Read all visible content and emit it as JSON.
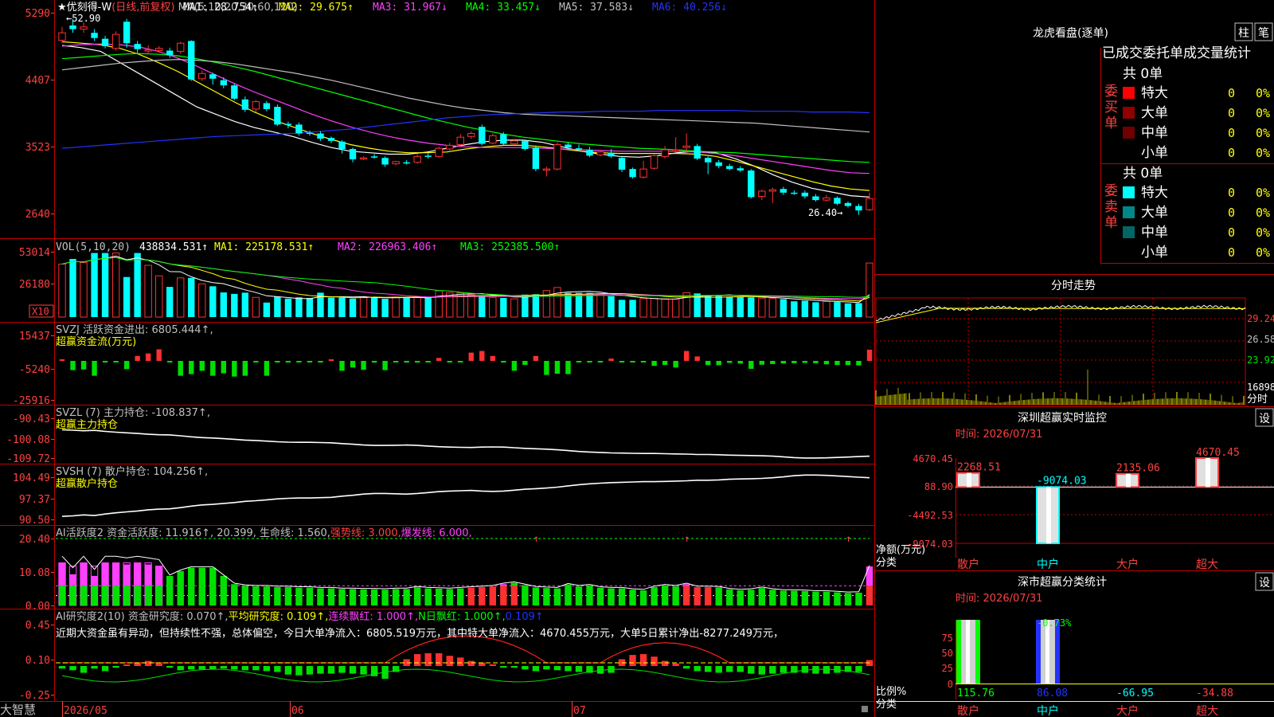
{
  "colors": {
    "up": "#ff3030",
    "down": "#00ffff",
    "vol_down": "#00ffff",
    "green": "#00e000",
    "white": "#ffffff",
    "yellow": "#ffff00",
    "magenta": "#ff40ff",
    "lime": "#00ff00",
    "blue": "#2233ff",
    "grey": "#c0c0c0",
    "frame": "#c00000"
  },
  "status_bar": {
    "brand": "大智慧"
  },
  "main_panel": {
    "title_prefix": "★",
    "stock_name": "优刻得-W",
    "period": "(日线,前复权)",
    "ma_header": "MA(5,10,20,30,60,120)",
    "ma": [
      {
        "label": "MA1: 28.754↑",
        "color": "#ffffff"
      },
      {
        "label": "MA2: 29.675↑",
        "color": "#ffff00"
      },
      {
        "label": "MA3: 31.967↓",
        "color": "#ff40ff"
      },
      {
        "label": "MA4: 33.457↓",
        "color": "#00ff00"
      },
      {
        "label": "MA5: 37.583↓",
        "color": "#c0c0c0"
      },
      {
        "label": "MA6: 40.256↓",
        "color": "#2233ff"
      }
    ],
    "y_labels": [
      "5290",
      "4407",
      "3523",
      "2640"
    ],
    "high_label": "52.90",
    "low_label": "26.40"
  },
  "vol_panel": {
    "title": "VOL(5,10,20)",
    "values": [
      {
        "label": "438834.531↑",
        "color": "#ffffff"
      },
      {
        "label": "MA1: 225178.531↑",
        "color": "#ffff00"
      },
      {
        "label": "MA2: 226963.406↑",
        "color": "#ff40ff"
      },
      {
        "label": "MA3: 252385.500↑",
        "color": "#00ff00"
      }
    ],
    "y_labels": [
      "53014",
      "26180"
    ],
    "unit": "X10"
  },
  "svzj_panel": {
    "title": "SVZJ  活跃资金进出: 6805.444↑,",
    "subtitle": "超赢资金流(万元)",
    "y_labels": [
      "15437",
      "-5240",
      "-25916"
    ]
  },
  "svzl_panel": {
    "title": "SVZL (7) 主力持仓: -108.837↑,",
    "subtitle": "超赢主力持仓",
    "y_labels": [
      "-90.43",
      "-100.08",
      "-109.72"
    ]
  },
  "svsh_panel": {
    "title": "SVSH (7) 散户持仓: 104.256↑,",
    "subtitle": "超赢散户持仓",
    "y_labels": [
      "104.49",
      "97.37",
      "90.50"
    ]
  },
  "ai2_panel": {
    "title": "AI活跃度2 资金活跃度: 11.916↑, 20.399, 生命线: 1.560,",
    "strong": "强势线: 3.000,",
    "burst": "爆发线: 6.000,",
    "y_labels": [
      "20.40",
      "10.08",
      "0.00"
    ]
  },
  "ai_research_panel": {
    "title": "AI研究度2(10) 资金研究度: 0.070↑,",
    "avg": "平均研究度: 0.109↑,",
    "lianxu": "连续飘红: 1.000↑,",
    "nday": "N日飘红: 1.000↑,",
    "last": "0.109↑",
    "comment": "近期大资金虽有异动，但持续性不强，总体偏空，今日大单净流入：6805.519万元，其中特大单净流入：4670.455万元，大单5日累计净出-8277.249万元，",
    "y_labels": [
      "0.45",
      "0.10",
      "-0.25"
    ]
  },
  "date_axis": [
    "2026/05",
    "06",
    "07"
  ],
  "dragon": {
    "title": "龙虎看盘(逐单)",
    "btn_zhu": "柱",
    "btn_bi": "笔",
    "header": "已成交委托单成交量统计",
    "buy": {
      "side_label": "委买单",
      "total": "共 0单",
      "rows": [
        {
          "label": "特大",
          "count": "0",
          "pct": "0%",
          "color": "#ff0000"
        },
        {
          "label": "大单",
          "count": "0",
          "pct": "0%",
          "color": "#900000"
        },
        {
          "label": "中单",
          "count": "0",
          "pct": "0%",
          "color": "#700000"
        },
        {
          "label": "小单",
          "count": "0",
          "pct": "0%",
          "color": ""
        }
      ]
    },
    "sell": {
      "side_label": "委卖单",
      "total": "共 0单",
      "rows": [
        {
          "label": "特大",
          "count": "0",
          "pct": "0%",
          "color": "#00ffff"
        },
        {
          "label": "大单",
          "count": "0",
          "pct": "0%",
          "color": "#008888"
        },
        {
          "label": "中单",
          "count": "0",
          "pct": "0%",
          "color": "#006666"
        },
        {
          "label": "小单",
          "count": "0",
          "pct": "0%",
          "color": ""
        }
      ]
    }
  },
  "intraday": {
    "title": "分时走势",
    "price_labels": [
      "29.24",
      "26.58",
      "23.92"
    ],
    "vol_label": "16898",
    "unit": "分时"
  },
  "sz_monitor": {
    "title": "深圳超赢实时监控",
    "btn": "设",
    "time": "时间: 2026/07/31",
    "y_labels": [
      "4670.45",
      "88.90",
      "-4492.53",
      "-9074.03"
    ],
    "unit_label": "净额(万元)",
    "class_label": "分类",
    "categories": [
      "散户",
      "中户",
      "大户",
      "超大"
    ],
    "values": [
      2268.51,
      -9074.03,
      2135.06,
      4670.45
    ],
    "value_labels": [
      "2268.51",
      "-9074.03",
      "2135.06",
      "4670.45"
    ],
    "ylim": [
      -9074.03,
      4670.45
    ]
  },
  "sz_class": {
    "title": "深市超赢分类统计",
    "btn": "设",
    "time": "时间: 2026/07/31",
    "y_labels": [
      "75",
      "50",
      "25",
      "0"
    ],
    "ratio_label": "比例%",
    "class_label": "分类",
    "categories": [
      "散户",
      "中户",
      "大户",
      "超大"
    ],
    "bottom_values": [
      "115.76",
      "86.08",
      "-66.95",
      "-34.88"
    ],
    "top_label": "-0.73%"
  },
  "chart_data": {
    "type": "candlestick",
    "title": "优刻得-W (日线,前复权)",
    "x_labels": [
      "2026/05",
      "06",
      "07"
    ],
    "ylim": [
      24.0,
      53.5
    ],
    "candles": [
      [
        50.0,
        51.0,
        51.8,
        49.6
      ],
      [
        52.0,
        51.5,
        52.9,
        51.0
      ],
      [
        51.5,
        51.8,
        52.4,
        51.0
      ],
      [
        51.0,
        50.3,
        51.5,
        49.9
      ],
      [
        50.2,
        49.2,
        50.6,
        48.9
      ],
      [
        48.9,
        50.8,
        51.2,
        48.6
      ],
      [
        52.5,
        49.6,
        52.9,
        49.0
      ],
      [
        49.5,
        48.8,
        49.9,
        48.2
      ],
      [
        48.7,
        48.7,
        49.3,
        48.1
      ],
      [
        48.6,
        48.9,
        49.2,
        48.3
      ],
      [
        48.6,
        48.0,
        49.0,
        47.6
      ],
      [
        48.5,
        49.6,
        49.8,
        48.2
      ],
      [
        49.9,
        44.7,
        50.0,
        44.5
      ],
      [
        44.8,
        45.5,
        45.9,
        44.5
      ],
      [
        45.4,
        44.8,
        45.6,
        44.0
      ],
      [
        44.6,
        43.9,
        45.0,
        43.5
      ],
      [
        43.9,
        42.1,
        44.1,
        41.9
      ],
      [
        42.0,
        40.6,
        42.4,
        40.3
      ],
      [
        40.7,
        41.7,
        41.9,
        40.3
      ],
      [
        41.5,
        40.7,
        41.8,
        40.4
      ],
      [
        41.0,
        38.6,
        41.3,
        38.4
      ],
      [
        38.7,
        38.6,
        39.0,
        38.1
      ],
      [
        38.6,
        37.4,
        38.9,
        37.1
      ],
      [
        37.5,
        37.4,
        37.8,
        37.1
      ],
      [
        37.4,
        36.7,
        37.7,
        36.4
      ],
      [
        36.8,
        36.4,
        37.0,
        36.1
      ],
      [
        36.3,
        35.3,
        36.5,
        34.7
      ],
      [
        35.3,
        33.9,
        35.5,
        33.5
      ],
      [
        34.0,
        34.1,
        34.3,
        33.8
      ],
      [
        34.3,
        34.2,
        34.6,
        34.0
      ],
      [
        34.1,
        33.2,
        34.3,
        32.9
      ],
      [
        33.3,
        33.6,
        33.7,
        33.1
      ],
      [
        33.5,
        33.4,
        33.8,
        33.2
      ],
      [
        33.5,
        34.3,
        34.6,
        33.3
      ],
      [
        34.4,
        34.3,
        34.7,
        34.0
      ],
      [
        34.3,
        35.4,
        35.6,
        34.1
      ],
      [
        35.3,
        35.8,
        36.1,
        35.1
      ],
      [
        35.9,
        36.9,
        37.3,
        35.6
      ],
      [
        37.0,
        37.4,
        37.7,
        36.7
      ],
      [
        38.3,
        36.0,
        38.6,
        35.8
      ],
      [
        36.1,
        37.1,
        37.4,
        35.9
      ],
      [
        37.3,
        36.0,
        37.6,
        35.8
      ],
      [
        36.0,
        36.4,
        36.7,
        35.8
      ],
      [
        36.4,
        35.3,
        36.6,
        35.1
      ],
      [
        35.5,
        32.6,
        35.8,
        32.3
      ],
      [
        32.6,
        32.6,
        32.9,
        31.6
      ],
      [
        32.6,
        35.9,
        36.2,
        32.4
      ],
      [
        35.9,
        35.5,
        36.2,
        35.2
      ],
      [
        35.4,
        35.2,
        35.9,
        35.0
      ],
      [
        35.2,
        34.4,
        35.6,
        34.2
      ],
      [
        34.5,
        34.9,
        35.2,
        34.3
      ],
      [
        34.8,
        34.3,
        35.3,
        34.1
      ],
      [
        34.1,
        32.5,
        34.3,
        32.2
      ],
      [
        32.6,
        31.5,
        32.8,
        31.3
      ],
      [
        31.5,
        32.6,
        33.7,
        31.3
      ],
      [
        32.7,
        34.4,
        34.6,
        32.5
      ],
      [
        34.3,
        35.2,
        35.7,
        34.0
      ],
      [
        35.1,
        35.2,
        36.9,
        34.8
      ],
      [
        35.5,
        35.7,
        37.4,
        35.0
      ],
      [
        35.7,
        34.0,
        36.0,
        33.8
      ],
      [
        34.1,
        33.5,
        34.3,
        31.9
      ],
      [
        33.5,
        33.0,
        33.8,
        32.7
      ],
      [
        33.0,
        32.6,
        33.3,
        32.4
      ],
      [
        32.7,
        32.4,
        33.0,
        32.2
      ],
      [
        32.4,
        28.8,
        32.6,
        28.6
      ],
      [
        28.9,
        29.6,
        29.8,
        28.4
      ],
      [
        29.6,
        29.8,
        30.1,
        28.0
      ],
      [
        29.9,
        29.4,
        30.2,
        29.1
      ],
      [
        29.4,
        29.3,
        29.7,
        29.1
      ],
      [
        29.4,
        28.9,
        29.7,
        28.6
      ],
      [
        28.9,
        28.4,
        29.2,
        28.2
      ],
      [
        28.4,
        28.7,
        29.1,
        28.2
      ],
      [
        28.7,
        27.9,
        28.9,
        27.7
      ],
      [
        28.0,
        27.6,
        28.2,
        27.4
      ],
      [
        27.6,
        27.0,
        27.9,
        26.4
      ],
      [
        27.1,
        28.6,
        29.4,
        26.9
      ]
    ],
    "ma_series": [
      {
        "name": "MA1",
        "color": "#ffffff",
        "values": [
          49.3,
          49.0,
          48.5,
          47.0,
          45.5,
          44.0,
          42.5,
          41.0,
          40.0,
          39.0,
          38.2,
          37.6,
          37.0,
          36.2,
          35.5,
          35.0,
          34.8,
          34.6,
          34.6,
          34.9,
          35.4,
          35.9,
          36.3,
          36.5,
          36.5,
          36.2,
          35.6,
          35.0,
          34.6,
          34.3,
          34.2,
          34.4,
          34.8,
          35.0,
          34.8,
          34.0,
          33.0,
          31.8,
          30.8,
          30.0,
          29.5,
          29.0,
          28.8
        ]
      },
      {
        "name": "MA2",
        "color": "#ffff00",
        "values": [
          49.8,
          49.6,
          49.4,
          48.9,
          48.1,
          47.0,
          45.8,
          44.4,
          43.0,
          41.6,
          40.3,
          39.2,
          38.3,
          37.4,
          36.6,
          35.9,
          35.4,
          35.0,
          34.8,
          34.8,
          34.9,
          35.3,
          35.6,
          35.8,
          35.8,
          35.6,
          35.3,
          35.0,
          34.8,
          34.7,
          34.7,
          34.7,
          34.7,
          34.6,
          34.3,
          33.7,
          33.0,
          32.3,
          31.6,
          30.9,
          30.3,
          29.9,
          29.7
        ]
      },
      {
        "name": "MA3",
        "color": "#ff40ff",
        "values": [
          49.2,
          49.4,
          49.5,
          49.4,
          49.1,
          48.5,
          47.6,
          46.5,
          45.3,
          44.1,
          43.0,
          42.0,
          41.0,
          40.0,
          39.1,
          38.3,
          37.6,
          37.0,
          36.5,
          36.1,
          35.8,
          35.6,
          35.5,
          35.5,
          35.5,
          35.4,
          35.3,
          35.2,
          35.1,
          35.0,
          35.0,
          35.0,
          35.0,
          34.9,
          34.7,
          34.4,
          34.0,
          33.6,
          33.2,
          32.8,
          32.4,
          32.1,
          32.0
        ]
      },
      {
        "name": "MA4",
        "color": "#00ff00",
        "values": [
          47.5,
          47.7,
          47.9,
          48.1,
          48.2,
          48.1,
          47.9,
          47.5,
          47.0,
          46.4,
          45.8,
          45.1,
          44.4,
          43.7,
          43.0,
          42.3,
          41.6,
          40.9,
          40.2,
          39.5,
          38.9,
          38.3,
          37.8,
          37.3,
          36.9,
          36.6,
          36.3,
          36.0,
          35.8,
          35.6,
          35.4,
          35.3,
          35.2,
          35.0,
          34.9,
          34.8,
          34.6,
          34.4,
          34.2,
          34.0,
          33.8,
          33.6,
          33.5
        ]
      },
      {
        "name": "MA5",
        "color": "#c0c0c0",
        "values": [
          46.0,
          46.3,
          46.6,
          46.9,
          47.1,
          47.3,
          47.4,
          47.3,
          47.1,
          46.8,
          46.4,
          46.0,
          45.6,
          45.1,
          44.6,
          44.0,
          43.4,
          42.8,
          42.2,
          41.7,
          41.2,
          40.8,
          40.5,
          40.2,
          40.0,
          39.9,
          39.8,
          39.7,
          39.6,
          39.5,
          39.4,
          39.3,
          39.2,
          39.1,
          39.0,
          38.9,
          38.8,
          38.6,
          38.4,
          38.2,
          38.0,
          37.8,
          37.6
        ]
      },
      {
        "name": "MA6",
        "color": "#2233ff",
        "values": [
          35.4,
          35.6,
          35.8,
          36.0,
          36.2,
          36.4,
          36.6,
          36.8,
          37.0,
          37.1,
          37.2,
          37.3,
          37.4,
          37.6,
          37.8,
          38.0,
          38.3,
          38.6,
          38.9,
          39.2,
          39.5,
          39.7,
          39.9,
          40.0,
          40.1,
          40.2,
          40.3,
          40.3,
          40.4,
          40.4,
          40.4,
          40.5,
          40.5,
          40.5,
          40.5,
          40.5,
          40.4,
          40.4,
          40.4,
          40.3,
          40.3,
          40.3,
          40.2
        ]
      }
    ],
    "volume": [
      430000,
      472000,
      442000,
      520000,
      520000,
      520000,
      325000,
      520000,
      420000,
      335000,
      245000,
      318000,
      318000,
      270000,
      250000,
      200000,
      188000,
      198000,
      160000,
      118000,
      165000,
      150000,
      160000,
      155000,
      198000,
      158000,
      158000,
      150000,
      163000,
      163000,
      148000,
      162000,
      155000,
      165000,
      155000,
      213000,
      196000,
      196000,
      180000,
      170000,
      160000,
      155000,
      148000,
      182000,
      185000,
      215000,
      240000,
      196000,
      196000,
      196000,
      185000,
      170000,
      140000,
      140000,
      150000,
      153000,
      148000,
      146000,
      198000,
      192000,
      174000,
      172000,
      165000,
      162000,
      160000,
      154000,
      150000,
      146000,
      128000,
      133000,
      120000,
      127000,
      122000,
      111000,
      113000,
      438835
    ],
    "svzj": [
      800,
      -5600,
      -5200,
      -9000,
      -900,
      -500,
      -5000,
      3000,
      4500,
      7000,
      -400,
      -9000,
      -8000,
      -6000,
      -9000,
      -7500,
      -9500,
      -9000,
      -500,
      -9000,
      -400,
      -100,
      -500,
      -600,
      -100,
      0,
      -6000,
      -4000,
      -5400,
      -1000,
      -5600,
      -400,
      -1000,
      -1000,
      -900,
      1800,
      -600,
      -600,
      5000,
      6000,
      3000,
      -500,
      -6000,
      -2400,
      3000,
      -8500,
      -7800,
      -8000,
      -500,
      -500,
      -500,
      1400,
      -200,
      -200,
      -600,
      -3000,
      -2400,
      -4000,
      6000,
      2700,
      -2500,
      -2600,
      -1200,
      -1600,
      -4800,
      -2300,
      -1900,
      -1600,
      -1400,
      -1200,
      -1400,
      -2100,
      -2400,
      -2500,
      -2700,
      6805
    ],
    "svzl": [
      -96.0,
      -96.2,
      -96.5,
      -96.3,
      -96.8,
      -97.2,
      -97.5,
      -97.8,
      -98.2,
      -98.4,
      -98.5,
      -98.9,
      -99.4,
      -99.8,
      -100.0,
      -100.3,
      -100.6,
      -101.0,
      -101.2,
      -101.5,
      -101.8,
      -102.0,
      -102.1,
      -102.1,
      -102.2,
      -102.3,
      -102.7,
      -103.0,
      -103.4,
      -103.6,
      -103.6,
      -103.5,
      -103.4,
      -103.6,
      -103.9,
      -104.2,
      -104.4,
      -104.5,
      -104.6,
      -104.4,
      -104.3,
      -104.4,
      -104.7,
      -105.0,
      -105.2,
      -105.4,
      -105.7,
      -106.1,
      -106.5,
      -106.8,
      -107.0,
      -107.2,
      -107.3,
      -107.4,
      -107.5,
      -107.5,
      -107.6,
      -107.7,
      -107.8,
      -108.0,
      -108.0,
      -108.1,
      -108.3,
      -108.4,
      -108.5,
      -108.6,
      -108.8,
      -109.1,
      -109.5,
      -109.7,
      -109.7,
      -109.6,
      -109.4,
      -109.2,
      -109.0,
      -108.8
    ]
  }
}
